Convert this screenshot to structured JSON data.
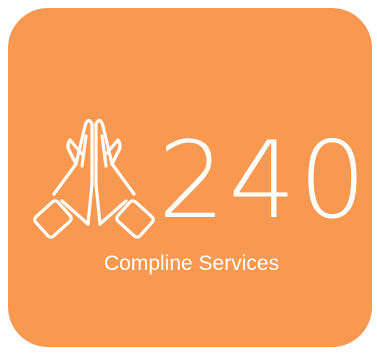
{
  "app_icon": {
    "background_color": "#f99951",
    "icon_name": "praying-hands-icon",
    "count": "240",
    "service_name": "Compline Services"
  }
}
